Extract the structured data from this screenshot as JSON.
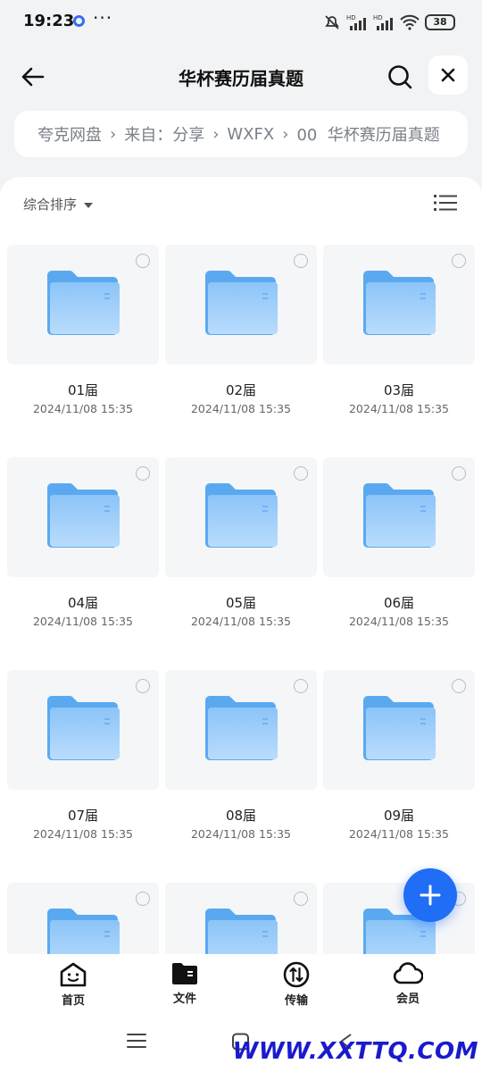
{
  "status_bar": {
    "time": "19:23",
    "battery": "38"
  },
  "header": {
    "title": "华杯赛历届真题"
  },
  "breadcrumb": [
    "夸克网盘",
    "来自：分享",
    "WXFX",
    "00  华杯赛历届真题"
  ],
  "sort": {
    "label": "综合排序"
  },
  "folders": [
    {
      "name": "01届",
      "date": "2024/11/08 15:35"
    },
    {
      "name": "02届",
      "date": "2024/11/08 15:35"
    },
    {
      "name": "03届",
      "date": "2024/11/08 15:35"
    },
    {
      "name": "04届",
      "date": "2024/11/08 15:35"
    },
    {
      "name": "05届",
      "date": "2024/11/08 15:35"
    },
    {
      "name": "06届",
      "date": "2024/11/08 15:35"
    },
    {
      "name": "07届",
      "date": "2024/11/08 15:35"
    },
    {
      "name": "08届",
      "date": "2024/11/08 15:35"
    },
    {
      "name": "09届",
      "date": "2024/11/08 15:35"
    },
    {
      "name": "",
      "date": ""
    },
    {
      "name": "",
      "date": ""
    },
    {
      "name": "",
      "date": ""
    }
  ],
  "tabs": [
    {
      "label": "首页",
      "icon": "home-face-icon"
    },
    {
      "label": "文件",
      "icon": "folder-icon"
    },
    {
      "label": "传输",
      "icon": "transfer-icon"
    },
    {
      "label": "会员",
      "icon": "cloud-icon"
    }
  ],
  "watermark": "WWW.XXTTQ.COM",
  "colors": {
    "accent": "#1f6ef5",
    "folder": "#6fb3f4"
  }
}
